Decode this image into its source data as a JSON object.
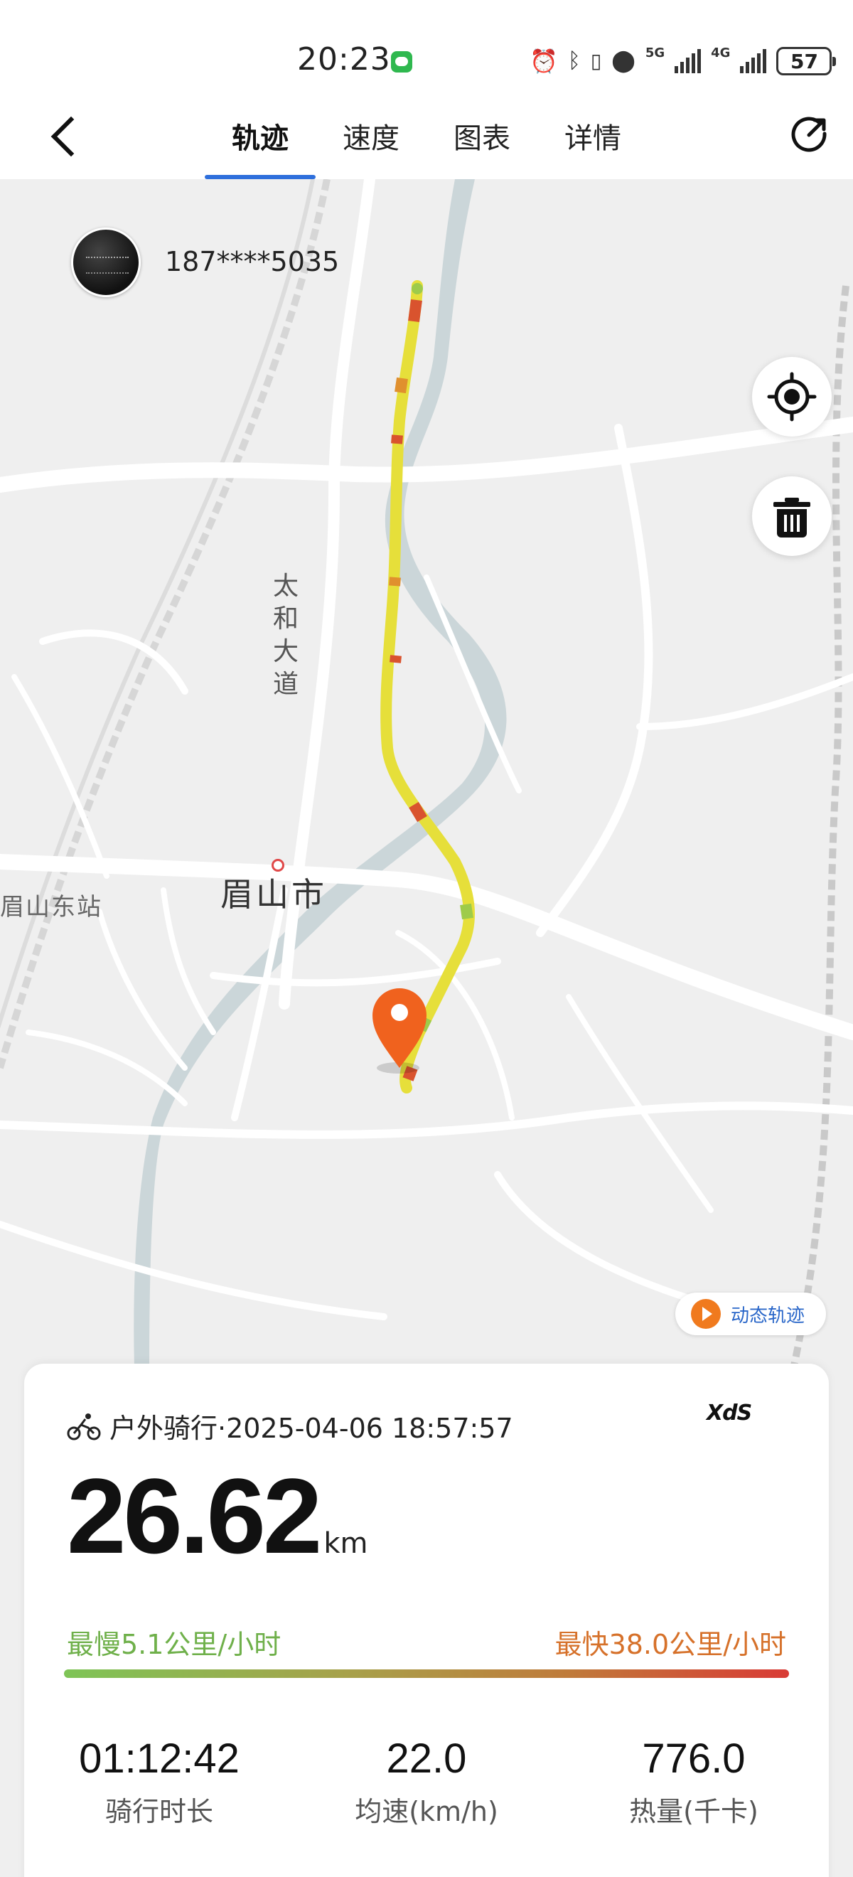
{
  "status_bar": {
    "time": "20:23",
    "network_1": "5G",
    "network_2": "4G",
    "battery": "57",
    "icons": [
      "wechat-icon",
      "alarm-icon",
      "bluetooth-icon",
      "vibrate-icon",
      "location-icon",
      "signal-icon",
      "battery-icon"
    ]
  },
  "header": {
    "tabs": [
      {
        "label": "轨迹",
        "active": true
      },
      {
        "label": "速度",
        "active": false
      },
      {
        "label": "图表",
        "active": false
      },
      {
        "label": "详情",
        "active": false
      }
    ]
  },
  "map": {
    "user_id": "187****5035",
    "road_label": "太和大道",
    "city_label": "眉山市",
    "station_label": "眉山东站",
    "replay_label": "动态轨迹",
    "colors": {
      "track": "#e6df3a",
      "track_slow": "#9ecb4a",
      "track_fast": "#d9532e",
      "river": "#cbd6d9",
      "pin": "#f0621e"
    }
  },
  "summary": {
    "activity": "户外骑行·2025-04-06 18:57:57",
    "brand": "XdS",
    "distance": "26.62",
    "distance_unit": "km",
    "slowest": "最慢5.1公里/小时",
    "fastest": "最快38.0公里/小时",
    "stats": [
      {
        "value": "01:12:42",
        "label": "骑行时长"
      },
      {
        "value": "22.0",
        "label": "均速(km/h)"
      },
      {
        "value": "776.0",
        "label": "热量(千卡)"
      }
    ]
  }
}
